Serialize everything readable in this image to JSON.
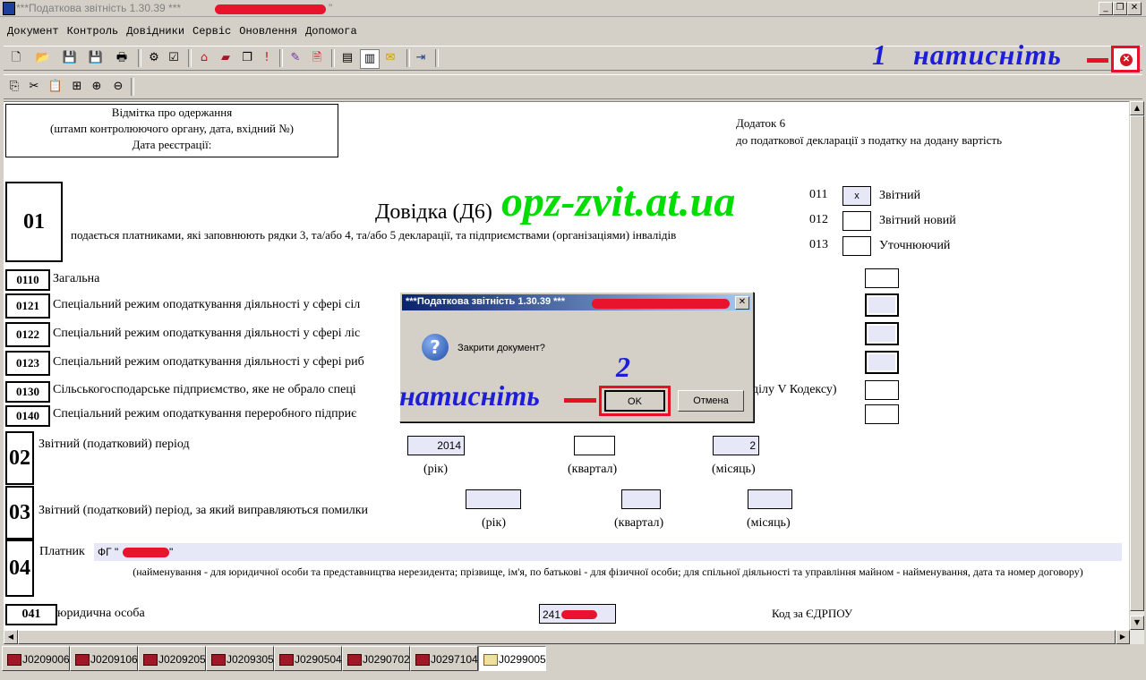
{
  "window": {
    "title": "***Податкова звітність 1.30.39 ***",
    "title_suffix": "\""
  },
  "menu": [
    "Документ",
    "Контроль",
    "Довідники",
    "Сервіс",
    "Оновлення",
    "Допомога"
  ],
  "doc": {
    "stamp_lines": [
      "Відмітка про одержання",
      "(штамп контролюючого органу, дата, вхідний №)",
      "Дата реєстрації:"
    ],
    "appendix_lines": [
      "Додаток 6",
      "до податкової декларації з податку на додану вартість"
    ],
    "section01_code": "01",
    "form_title": "Довідка (Д6)",
    "form_subtitle": "подається платниками, які заповнюють рядки 3, та/або 4, та/або 5 декларації, та підприємствами (організаціями) інвалідів",
    "watermark": "opz-zvit.at.ua",
    "report_types": [
      {
        "code": "011",
        "label": "Звітний",
        "mark": "x"
      },
      {
        "code": "012",
        "label": "Звітний новий",
        "mark": ""
      },
      {
        "code": "013",
        "label": "Уточнюючий",
        "mark": ""
      }
    ],
    "rows": [
      {
        "code": "0110",
        "label": "Загальна"
      },
      {
        "code": "0121",
        "label": "Спеціальний режим оподаткування діяльності у сфері сіл"
      },
      {
        "code": "0122",
        "label": "Спеціальний режим оподаткування діяльності у сфері ліс"
      },
      {
        "code": "0123",
        "label": "Спеціальний режим оподаткування діяльності у сфері риб"
      },
      {
        "code": "0130",
        "label": "Сільськогосподарське підприємство, яке не обрало спеці"
      },
      {
        "code": "0140",
        "label": "Спеціальний режим оподаткування переробного підприє"
      }
    ],
    "row0130_tail": "ділу V Кодексу)",
    "section02": {
      "code": "02",
      "label": "Звітний (податковий) період",
      "year": "2014",
      "quarter": "",
      "month": "2",
      "year_label": "(рік)",
      "quarter_label": "(квартал)",
      "month_label": "(місяць)"
    },
    "section03": {
      "code": "03",
      "label": "Звітний (податковий) період, за який виправляються помилки",
      "year_label": "(рік)",
      "quarter_label": "(квартал)",
      "month_label": "(місяць)"
    },
    "section04": {
      "code": "04",
      "label": "Платник",
      "payer_value_prefix": "ФГ \"",
      "payer_value_suffix": "\"",
      "note": "(найменування - для юридичної особи та представництва нерезидента; прізвище, ім'я, по батькові - для фізичної особи; для спільної діяльності та управління майном - найменування, дата та номер договору)"
    },
    "row041": {
      "code": "041",
      "label": "юридична особа",
      "value_prefix": "241",
      "edrpou_label": "Код за ЄДРПОУ"
    }
  },
  "tabs": [
    {
      "label": "J0209006",
      "active": false
    },
    {
      "label": "J0209106",
      "active": false
    },
    {
      "label": "J0209205",
      "active": false
    },
    {
      "label": "J0209305",
      "active": false
    },
    {
      "label": "J0290504",
      "active": false
    },
    {
      "label": "J0290702",
      "active": false
    },
    {
      "label": "J0297104",
      "active": false
    },
    {
      "label": "J0299005",
      "active": true
    }
  ],
  "dialog": {
    "title": "***Податкова звітність 1.30.39 ***",
    "message": "Закрити документ?",
    "ok_label": "OK",
    "cancel_label": "Отмена",
    "icon": "question-icon"
  },
  "annotations": {
    "step1_number": "1",
    "step1_text": "натисніть",
    "step2_number": "2",
    "step2_text": "натисніть"
  },
  "colors": {
    "annotation": "#1e1ed8",
    "highlight": "#e81026",
    "watermark": "#00dd00",
    "dialog_title": "#0a246a",
    "input_fill": "#e6e8f8"
  }
}
